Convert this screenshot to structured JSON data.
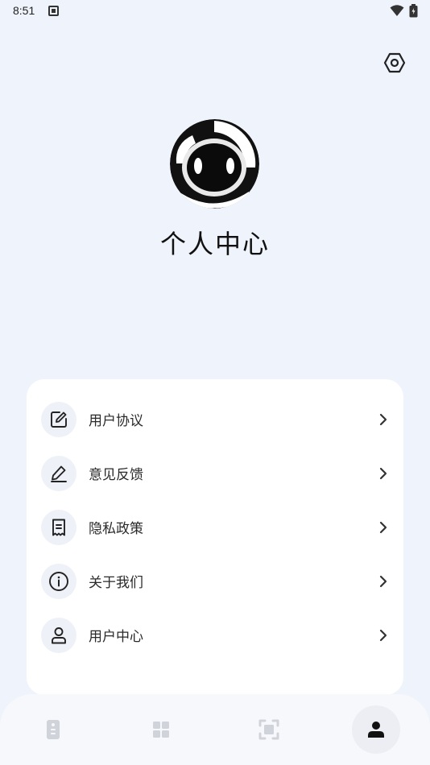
{
  "status_bar": {
    "time": "8:51"
  },
  "profile": {
    "title": "个人中心"
  },
  "menu": {
    "items": [
      {
        "label": "用户协议",
        "icon": "edit-document-icon"
      },
      {
        "label": "意见反馈",
        "icon": "pen-icon"
      },
      {
        "label": "隐私政策",
        "icon": "receipt-icon"
      },
      {
        "label": "关于我们",
        "icon": "info-icon"
      },
      {
        "label": "用户中心",
        "icon": "user-icon"
      }
    ]
  },
  "bottom_nav": {
    "items": [
      {
        "icon": "remote-icon",
        "active": false
      },
      {
        "icon": "grid-icon",
        "active": false
      },
      {
        "icon": "scan-icon",
        "active": false
      },
      {
        "icon": "person-icon",
        "active": true
      }
    ]
  },
  "colors": {
    "background": "#eff3fb",
    "card": "#ffffff",
    "icon_bg": "#eef1f8",
    "inactive_icon": "#d0d3d9"
  }
}
